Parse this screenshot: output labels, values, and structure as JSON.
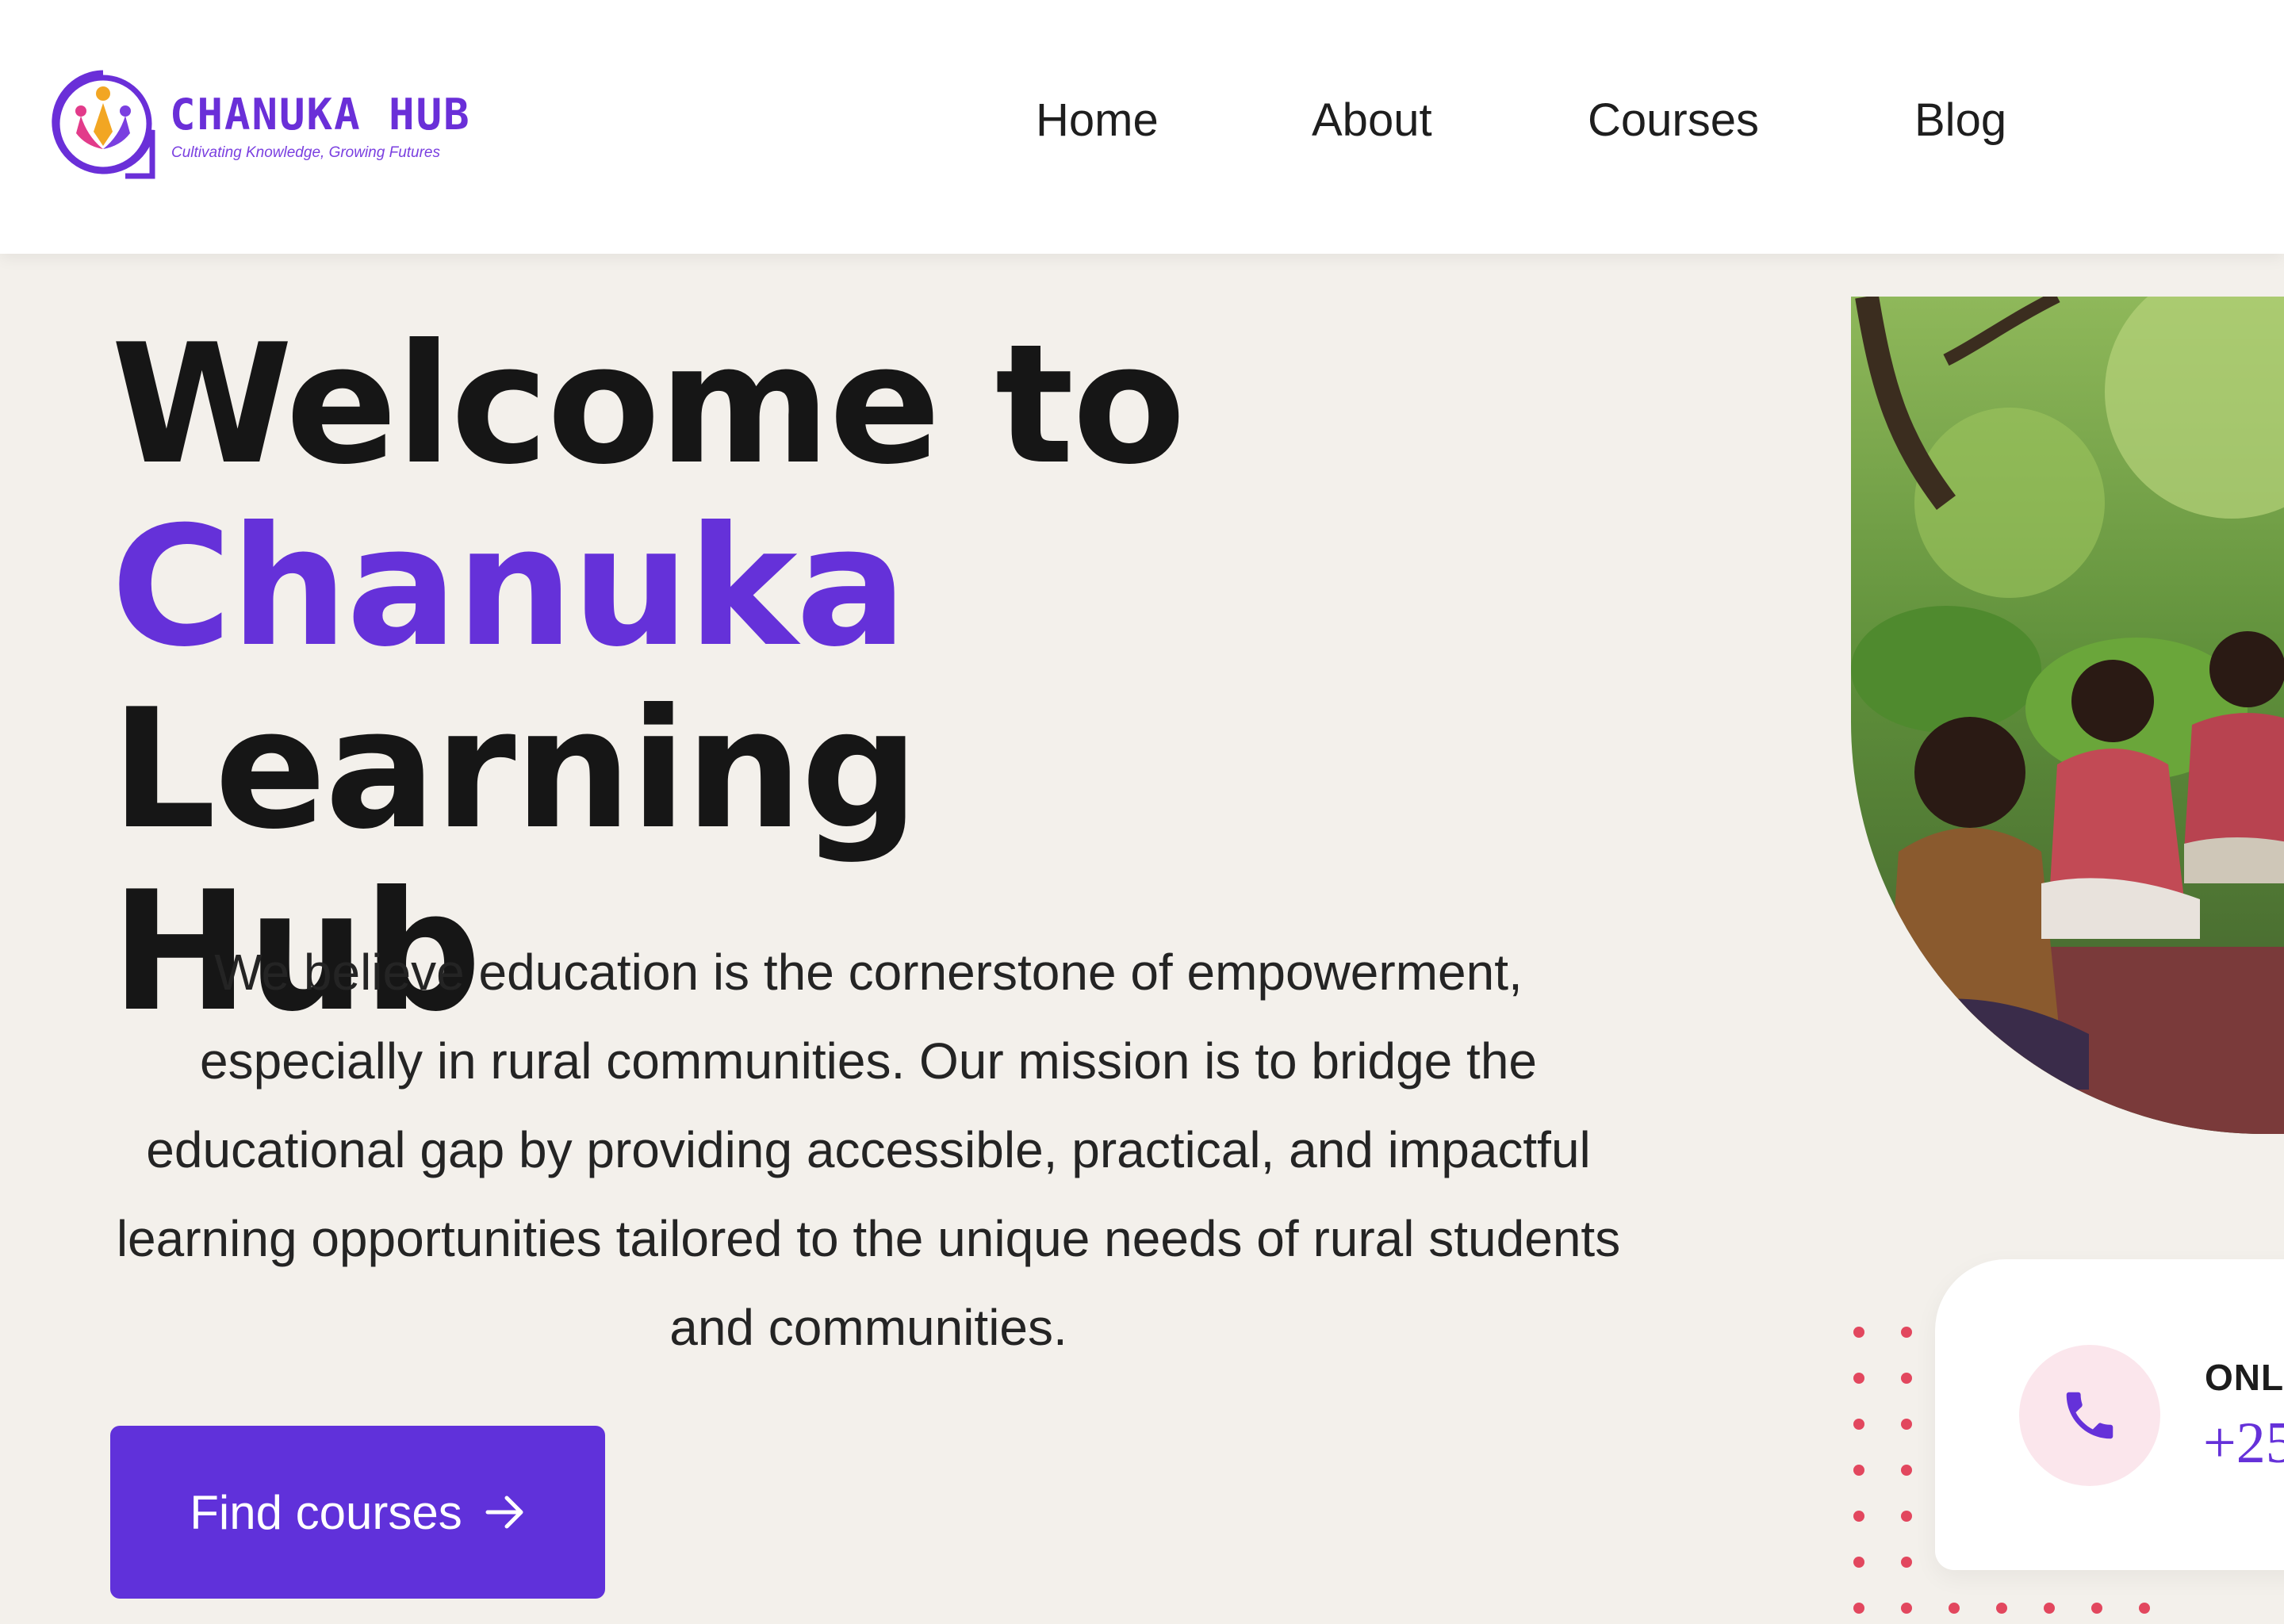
{
  "brand": {
    "name": "CHANUKA HUB",
    "tagline": "Cultivating Knowledge, Growing Futures"
  },
  "nav": {
    "items": [
      {
        "label": "Home"
      },
      {
        "label": "About"
      },
      {
        "label": "Courses"
      },
      {
        "label": "Blog"
      }
    ]
  },
  "hero": {
    "title_line1": "Welcome to",
    "title_accent": "Chanuka",
    "title_line2_rest": " Learning",
    "title_line3": "Hub",
    "description": "We believe education is the cornerstone of empowerment, especially in rural communities. Our mission is to bridge the educational gap by providing accessible, practical, and impactful learning opportunities tailored to the unique needs of rural students and communities.",
    "cta_label": "Find courses"
  },
  "contact": {
    "label": "ONLI",
    "number": "+25"
  },
  "icons": {
    "logo": "logo-emblem-icon",
    "cta_arrow": "arrow-right-icon",
    "phone": "phone-icon"
  },
  "colors": {
    "accent": "#6531d9",
    "button": "#6031da",
    "background": "#f3f0eb",
    "phone_bg": "#fbe6ec",
    "dots": "#e2475e"
  }
}
